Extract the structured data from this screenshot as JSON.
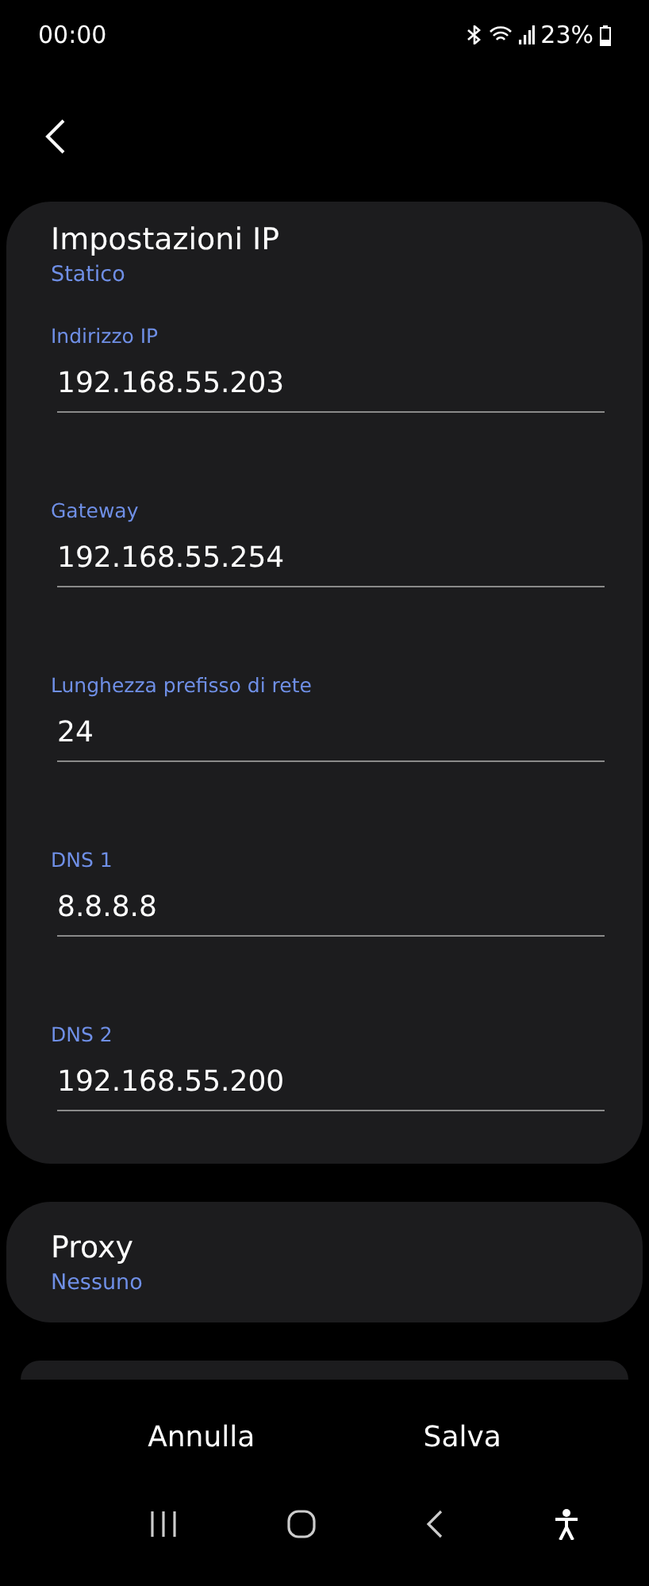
{
  "status_bar": {
    "time": "00:00",
    "battery": "23%"
  },
  "ip_settings": {
    "title": "Impostazioni IP",
    "value": "Statico",
    "fields": [
      {
        "label": "Indirizzo IP",
        "value": "192.168.55.203"
      },
      {
        "label": "Gateway",
        "value": "192.168.55.254"
      },
      {
        "label": "Lunghezza prefisso di rete",
        "value": "24"
      },
      {
        "label": "DNS 1",
        "value": "8.8.8.8"
      },
      {
        "label": "DNS 2",
        "value": "192.168.55.200"
      }
    ]
  },
  "proxy": {
    "title": "Proxy",
    "value": "Nessuno"
  },
  "buttons": [
    "Annulla",
    "Salva"
  ]
}
